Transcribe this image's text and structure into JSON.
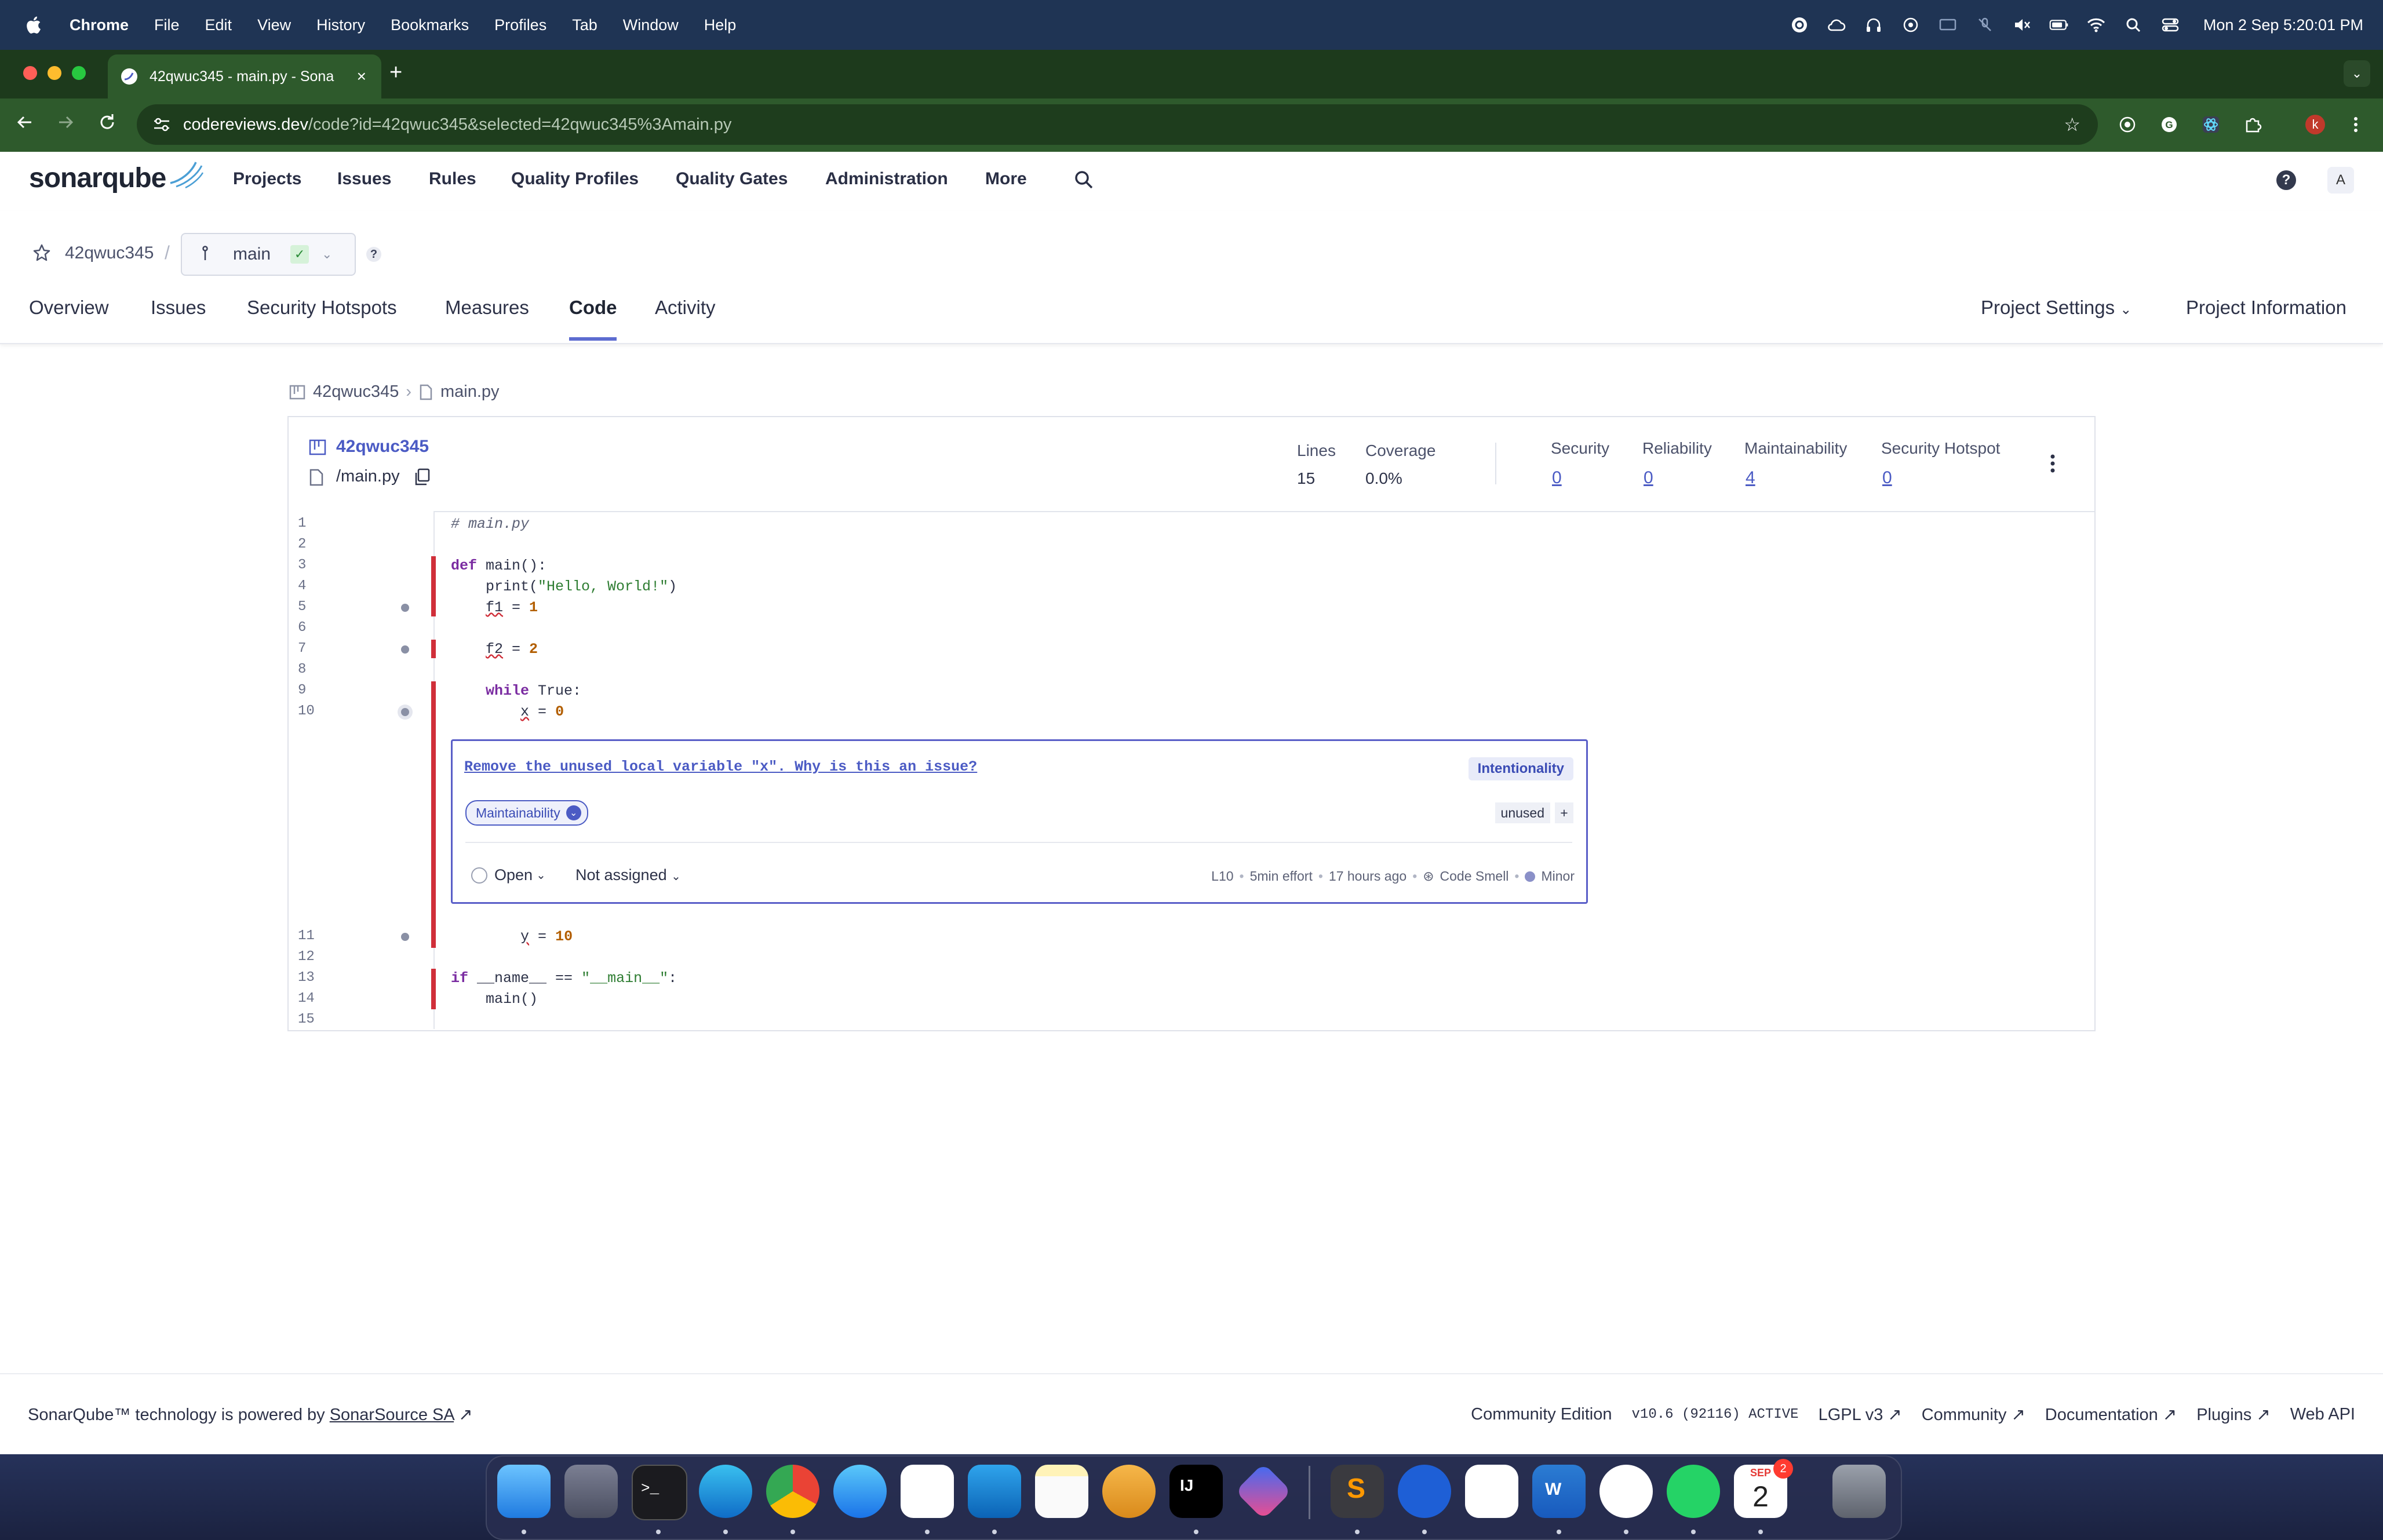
{
  "menubar": {
    "app": "Chrome",
    "items": [
      "File",
      "Edit",
      "View",
      "History",
      "Bookmarks",
      "Profiles",
      "Tab",
      "Window",
      "Help"
    ],
    "clock": "Mon 2 Sep  5:20:01 PM"
  },
  "browser": {
    "tab_title": "42qwuc345 - main.py - Sona",
    "url_host": "codereviews.dev",
    "url_path": "/code?id=42qwuc345&selected=42qwuc345%3Amain.py",
    "profile_initial": "k"
  },
  "sonar": {
    "logo": "sonarqube",
    "nav": [
      "Projects",
      "Issues",
      "Rules",
      "Quality Profiles",
      "Quality Gates",
      "Administration",
      "More"
    ],
    "avatar": "A",
    "help": "?"
  },
  "project": {
    "name": "42qwuc345",
    "branch": "main",
    "branch_help": "?",
    "tabs": [
      "Overview",
      "Issues",
      "Security Hotspots",
      "Measures",
      "Code",
      "Activity"
    ],
    "active_tab": "Code",
    "settings_label": "Project Settings",
    "info_label": "Project Information"
  },
  "breadcrumb": {
    "project": "42qwuc345",
    "file": "main.py"
  },
  "card": {
    "project": "42qwuc345",
    "file": "/main.py",
    "metrics": {
      "lines_label": "Lines",
      "lines_value": "15",
      "coverage_label": "Coverage",
      "coverage_value": "0.0%",
      "security_label": "Security",
      "security_value": "0",
      "reliability_label": "Reliability",
      "reliability_value": "0",
      "maintainability_label": "Maintainability",
      "maintainability_value": "4",
      "hotspot_label": "Security Hotspot",
      "hotspot_value": "0"
    }
  },
  "code_lines": [
    {
      "n": "1",
      "text": "# main.py"
    },
    {
      "n": "2",
      "text": ""
    },
    {
      "n": "3",
      "text": "def main():"
    },
    {
      "n": "4",
      "text": "    print(\"Hello, World!\")"
    },
    {
      "n": "5",
      "text": "    f1 = 1"
    },
    {
      "n": "6",
      "text": ""
    },
    {
      "n": "7",
      "text": "    f2 = 2"
    },
    {
      "n": "8",
      "text": ""
    },
    {
      "n": "9",
      "text": "    while True:"
    },
    {
      "n": "10",
      "text": "        x = 0"
    },
    {
      "n": "11",
      "text": "        y = 10"
    },
    {
      "n": "12",
      "text": ""
    },
    {
      "n": "13",
      "text": "if __name__ == \"__main__\":"
    },
    {
      "n": "14",
      "text": "    main()"
    },
    {
      "n": "15",
      "text": ""
    }
  ],
  "issue": {
    "message": "Remove the unused local variable \"x\".",
    "why_link": "Why is this an issue?",
    "attribute": "Intentionality",
    "quality": "Maintainability",
    "tag": "unused",
    "tag_add": "+",
    "status": "Open",
    "assignee": "Not assigned",
    "line": "L10",
    "effort": "5min effort",
    "age": "17 hours ago",
    "type": "Code Smell",
    "severity": "Minor"
  },
  "footer": {
    "powered_prefix": "SonarQube™ technology is powered by",
    "powered_link": "SonarSource SA",
    "edition": "Community Edition",
    "version": "v10.6 (92116) ACTIVE",
    "license": "LGPL v3",
    "community": "Community",
    "docs": "Documentation",
    "plugins": "Plugins",
    "api": "Web API"
  },
  "dock": {
    "calendar_month": "SEP",
    "calendar_day": "2",
    "calendar_badge": "2"
  },
  "colors": {
    "menubar": "#1f3454",
    "chrome_frame": "#2e5a2c",
    "sonar_accent": "#4b5bc4",
    "issue_marker": "#d02f3a"
  }
}
